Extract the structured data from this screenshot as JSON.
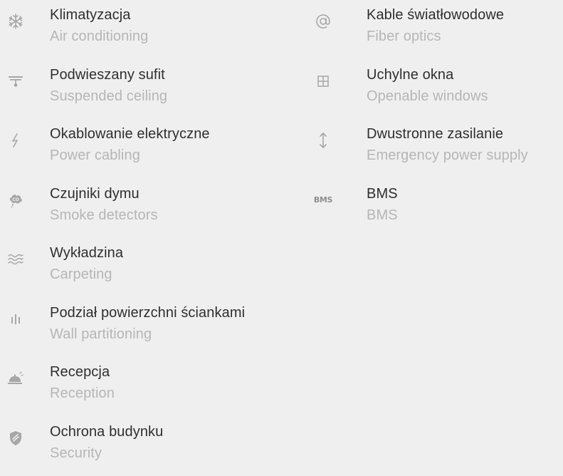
{
  "amenities_left": [
    {
      "icon": "snowflake-icon",
      "label_pl": "Klimatyzacja",
      "label_en": "Air conditioning"
    },
    {
      "icon": "ceiling-lamp-icon",
      "label_pl": "Podwieszany sufit",
      "label_en": "Suspended ceiling"
    },
    {
      "icon": "lightning-icon",
      "label_pl": "Okablowanie elektryczne",
      "label_en": "Power cabling"
    },
    {
      "icon": "smoke-detector-icon",
      "label_pl": "Czujniki dymu",
      "label_en": "Smoke detectors"
    },
    {
      "icon": "waves-icon",
      "label_pl": "Wykładzina",
      "label_en": "Carpeting"
    },
    {
      "icon": "partition-icon",
      "label_pl": "Podział powierzchni ściankami",
      "label_en": "Wall partitioning"
    },
    {
      "icon": "reception-bell-icon",
      "label_pl": "Recepcja",
      "label_en": "Reception"
    },
    {
      "icon": "shield-icon",
      "label_pl": "Ochrona budynku",
      "label_en": "Security"
    }
  ],
  "amenities_right": [
    {
      "icon": "at-sign-icon",
      "label_pl": "Kable światłowodowe",
      "label_en": "Fiber optics"
    },
    {
      "icon": "window-icon",
      "label_pl": "Uchylne okna",
      "label_en": "Openable windows"
    },
    {
      "icon": "up-down-arrow-icon",
      "label_pl": "Dwustronne zasilanie",
      "label_en": "Emergency power supply"
    },
    {
      "icon": "bms-icon",
      "label_pl": "BMS",
      "label_en": "BMS",
      "icon_text": "BMS",
      "smoke_icon_text": "CO"
    }
  ],
  "colors": {
    "background": "#efefef",
    "label_primary": "#2f2f2f",
    "label_secondary": "#b6b6b6",
    "icon": "#a7a7a7"
  }
}
